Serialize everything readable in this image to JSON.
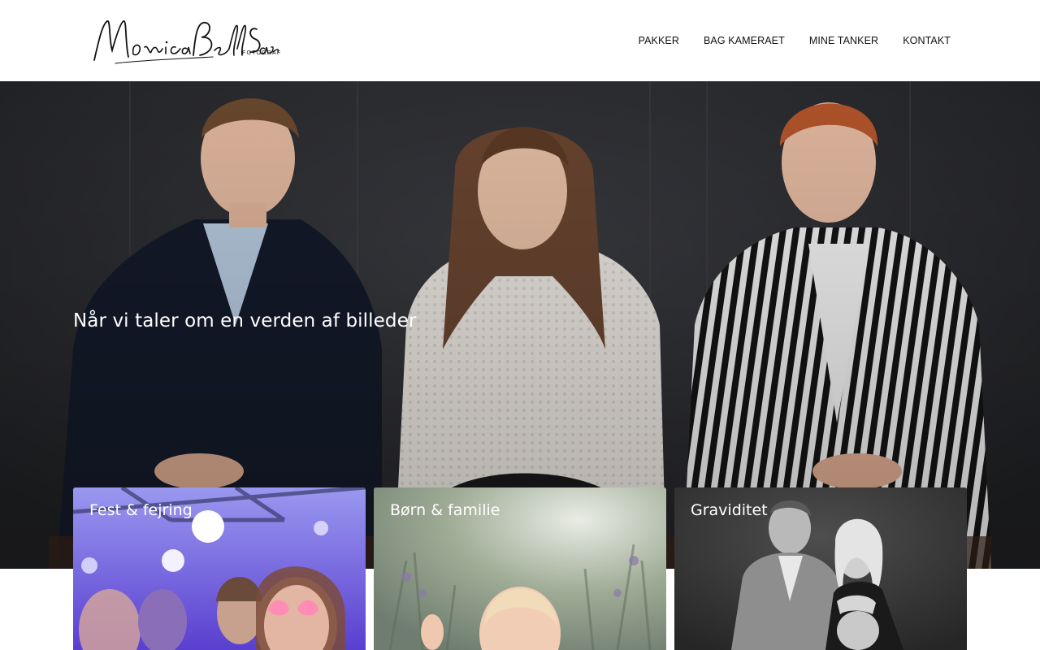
{
  "header": {
    "logo_alt": "Monica Bell Sass Fotograf",
    "logo_script": "MonicaBellSass",
    "logo_subtitle": "FOTOGRAF",
    "nav": [
      {
        "label": "PAKKER"
      },
      {
        "label": "BAG KAMERAET"
      },
      {
        "label": "MINE TANKER"
      },
      {
        "label": "KONTAKT"
      }
    ]
  },
  "hero": {
    "title": "Når vi taler om en verden af billeder"
  },
  "cards": [
    {
      "title": "Fest & fejring"
    },
    {
      "title": "Børn & familie"
    },
    {
      "title": "Graviditet"
    }
  ],
  "colors": {
    "hero_bg": "#2a2b2f",
    "text_light": "#ffffff",
    "nav_text": "#111111"
  }
}
